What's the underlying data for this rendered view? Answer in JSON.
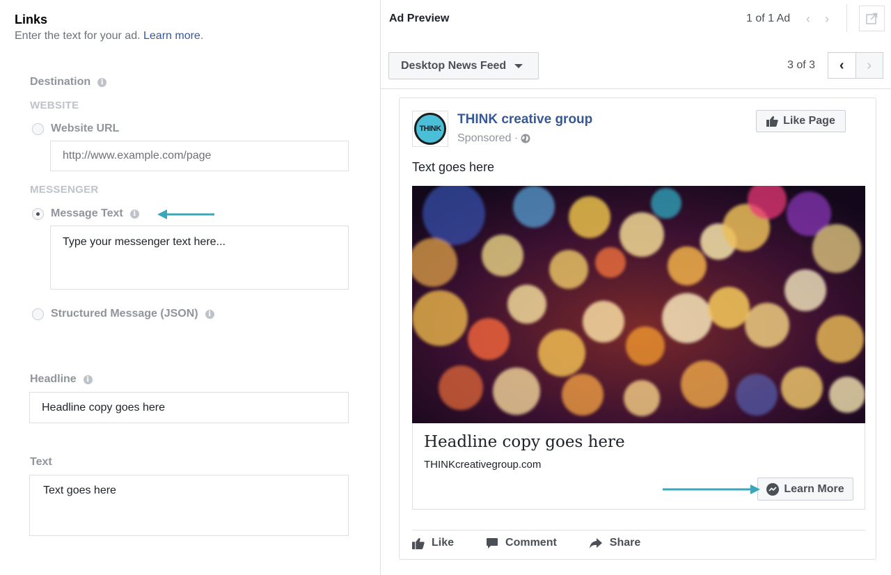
{
  "links_section": {
    "title": "Links",
    "subtitle": "Enter the text for your ad.",
    "learn_more": "Learn more",
    "period": "."
  },
  "destination": {
    "label": "Destination",
    "website_caption": "WEBSITE",
    "website_url_label": "Website URL",
    "website_url_placeholder": "http://www.example.com/page",
    "messenger_caption": "MESSENGER",
    "message_text_label": "Message Text",
    "message_text_placeholder": "Type your messenger text here...",
    "structured_label": "Structured Message (JSON)",
    "selected": "Message Text"
  },
  "headline": {
    "label": "Headline",
    "value": "Headline copy goes here"
  },
  "text": {
    "label": "Text",
    "value": "Text goes here"
  },
  "preview": {
    "title": "Ad Preview",
    "ad_count": "1 of 1 Ad",
    "placement": "Desktop News Feed",
    "page_count": "3 of 3"
  },
  "ad": {
    "page_name": "THINK creative group",
    "logo_text": "THINK",
    "sponsored": "Sponsored ·",
    "like_page": "Like Page",
    "post_text": "Text goes here",
    "headline": "Headline copy goes here",
    "domain": "THINKcreativegroup.com",
    "cta": "Learn More",
    "actions": [
      "Like",
      "Comment",
      "Share"
    ]
  },
  "colors": {
    "link_blue": "#365899",
    "annotation_arrow": "#3aa6b9",
    "muted_label": "#90949c",
    "border": "#dddfe2"
  }
}
